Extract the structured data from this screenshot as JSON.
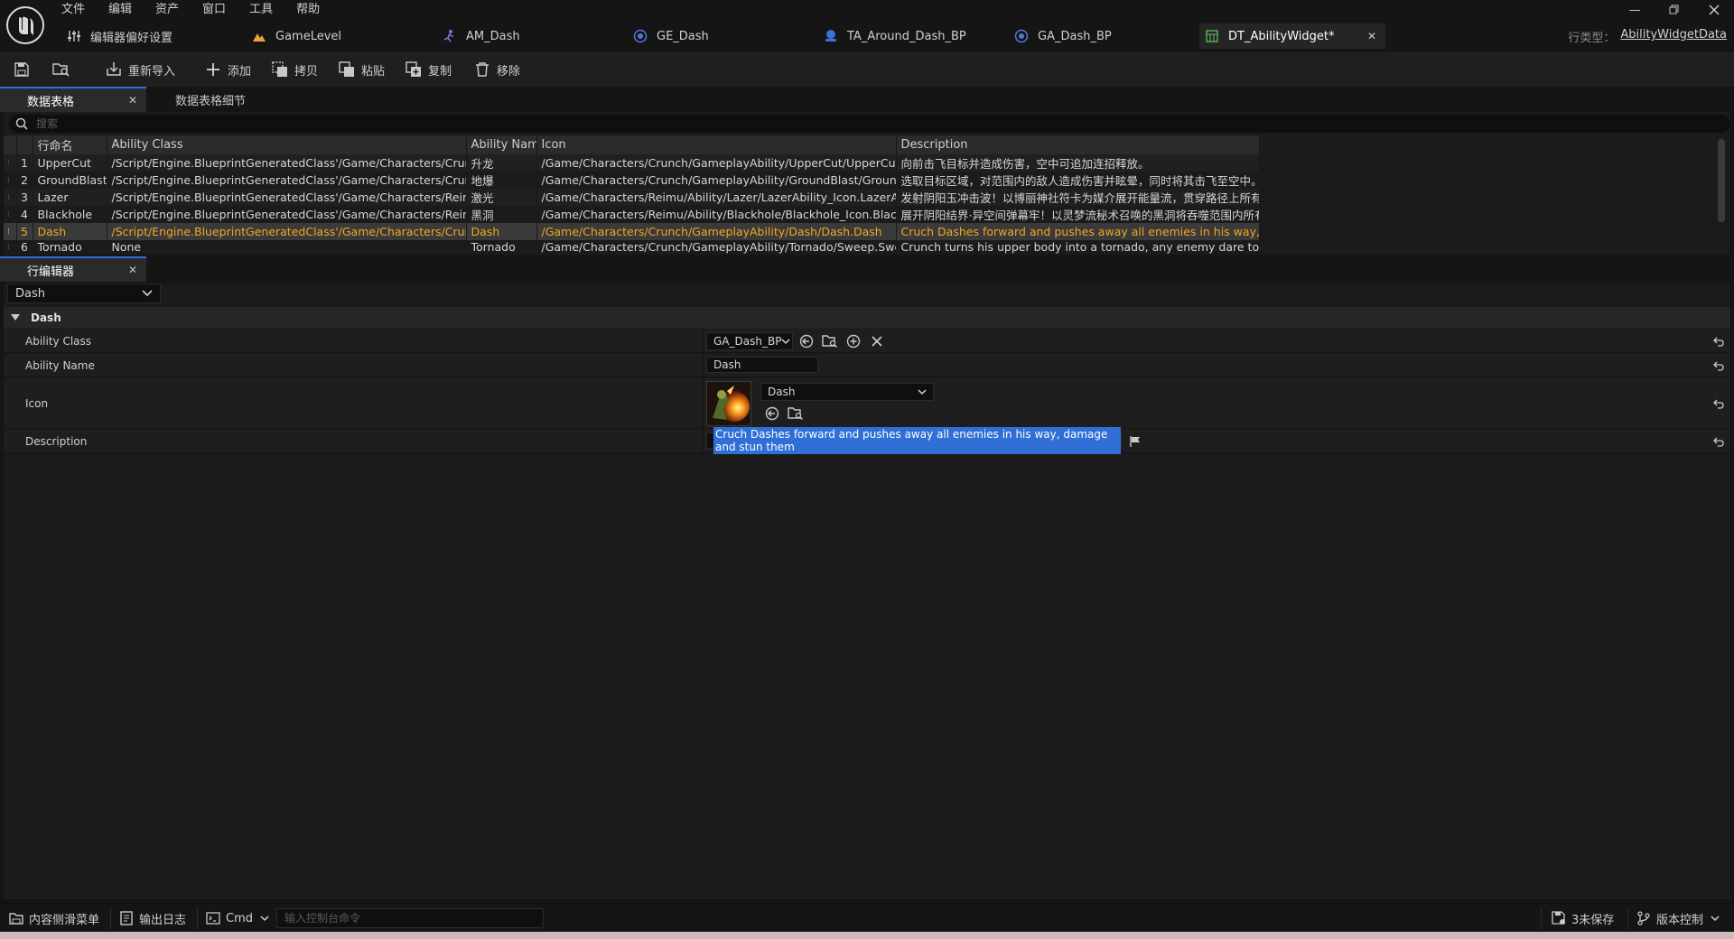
{
  "menu": [
    "文件",
    "编辑",
    "资产",
    "窗口",
    "工具",
    "帮助"
  ],
  "tabs": [
    {
      "label": "编辑器偏好设置",
      "icon": "sliders-icon"
    },
    {
      "label": "GameLevel",
      "icon": "level-icon"
    },
    {
      "label": "AM_Dash",
      "icon": "anim-montage-icon"
    },
    {
      "label": "GE_Dash",
      "icon": "blueprint-icon"
    },
    {
      "label": "TA_Around_Dash_BP",
      "icon": "actor-icon"
    },
    {
      "label": "GA_Dash_BP",
      "icon": "blueprint-icon"
    },
    {
      "label": "DT_AbilityWidget*",
      "icon": "datatable-icon"
    }
  ],
  "parent_type": {
    "label": "行类型：",
    "value": "AbilityWidgetData"
  },
  "toolbar": {
    "reimport": "重新导入",
    "add": "添加",
    "copy": "拷贝",
    "paste": "粘贴",
    "duplicate": "复制",
    "remove": "移除"
  },
  "datatable": {
    "tab_label": "数据表格",
    "details_tab_label": "数据表格细节",
    "search_placeholder": "搜索",
    "headers": [
      "行命名",
      "Ability Class",
      "Ability Name",
      "Icon",
      "Description"
    ],
    "rows": [
      {
        "num": "1",
        "name": "UpperCut",
        "class": "/Script/Engine.BlueprintGeneratedClass'/Game/Characters/Crunch/Gam",
        "aname": "升龙",
        "icon": "/Game/Characters/Crunch/GameplayAbility/UpperCut/UpperCut.UpperC",
        "desc": "向前击飞目标并造成伤害，空中可追加连招释放。"
      },
      {
        "num": "2",
        "name": "GroundBlast",
        "class": "/Script/Engine.BlueprintGeneratedClass'/Game/Characters/Crunch/Gam",
        "aname": "地爆",
        "icon": "/Game/Characters/Crunch/GameplayAbility/GroundBlast/GroundBlash.(",
        "desc": "选取目标区域，对范围内的敌人造成伤害并眩晕，同时将其击飞至空中。"
      },
      {
        "num": "3",
        "name": "Lazer",
        "class": "/Script/Engine.BlueprintGeneratedClass'/Game/Characters/Reimu/Abilit",
        "aname": "激光",
        "icon": "/Game/Characters/Reimu/Ability/Lazer/LazerAbility_Icon.LazerAbility_Ic",
        "desc": "发射阴阳玉冲击波！以博丽神社符卡为媒介展开能量流，贯穿路径上所有敌"
      },
      {
        "num": "4",
        "name": "Blackhole",
        "class": "/Script/Engine.BlueprintGeneratedClass'/Game/Characters/Reimu/Abilit",
        "aname": "黑洞",
        "icon": "/Game/Characters/Reimu/Ability/Blackhole/Blackhole_Icon.Blackhole_Ic",
        "desc": "展开阴阳结界·异空间弹幕牢！以灵梦流秘术召唤的黑洞将吞噬范围内所有敌"
      },
      {
        "num": "5",
        "name": "Dash",
        "class": "/Script/Engine.BlueprintGeneratedClass'/Game/Characters/Crunch/Gam",
        "aname": "Dash",
        "icon": "/Game/Characters/Crunch/GameplayAbility/Dash/Dash.Dash",
        "desc": "Cruch Dashes forward and pushes away all enemies in his way, damage a"
      },
      {
        "num": "6",
        "name": "Tornado",
        "class": "None",
        "aname": "Tornado",
        "icon": "/Game/Characters/Crunch/GameplayAbility/Tornado/Sweep.Sweep",
        "desc": "Crunch turns his upper body into a tornado, any enemy dare to get close"
      }
    ]
  },
  "row_editor": {
    "tab_label": "行编辑器",
    "selected_row": "Dash",
    "section": "Dash",
    "props": {
      "ability_class_label": "Ability Class",
      "ability_class_value": "GA_Dash_BP",
      "ability_name_label": "Ability Name",
      "ability_name_value": "Dash",
      "icon_label": "Icon",
      "icon_value": "Dash",
      "description_label": "Description",
      "description_value": "Cruch Dashes forward and pushes away all enemies in his way, damage and stun them"
    }
  },
  "statusbar": {
    "content_drawer": "内容侧滑菜单",
    "output_log": "输出日志",
    "cmd": "Cmd",
    "console_placeholder": "输入控制台命令",
    "unsaved": "3未保存",
    "source_control": "版本控制"
  },
  "colors": {
    "accent": "#2f6fd6",
    "selected_text": "#f2a622",
    "panel": "#1b1b1b"
  }
}
